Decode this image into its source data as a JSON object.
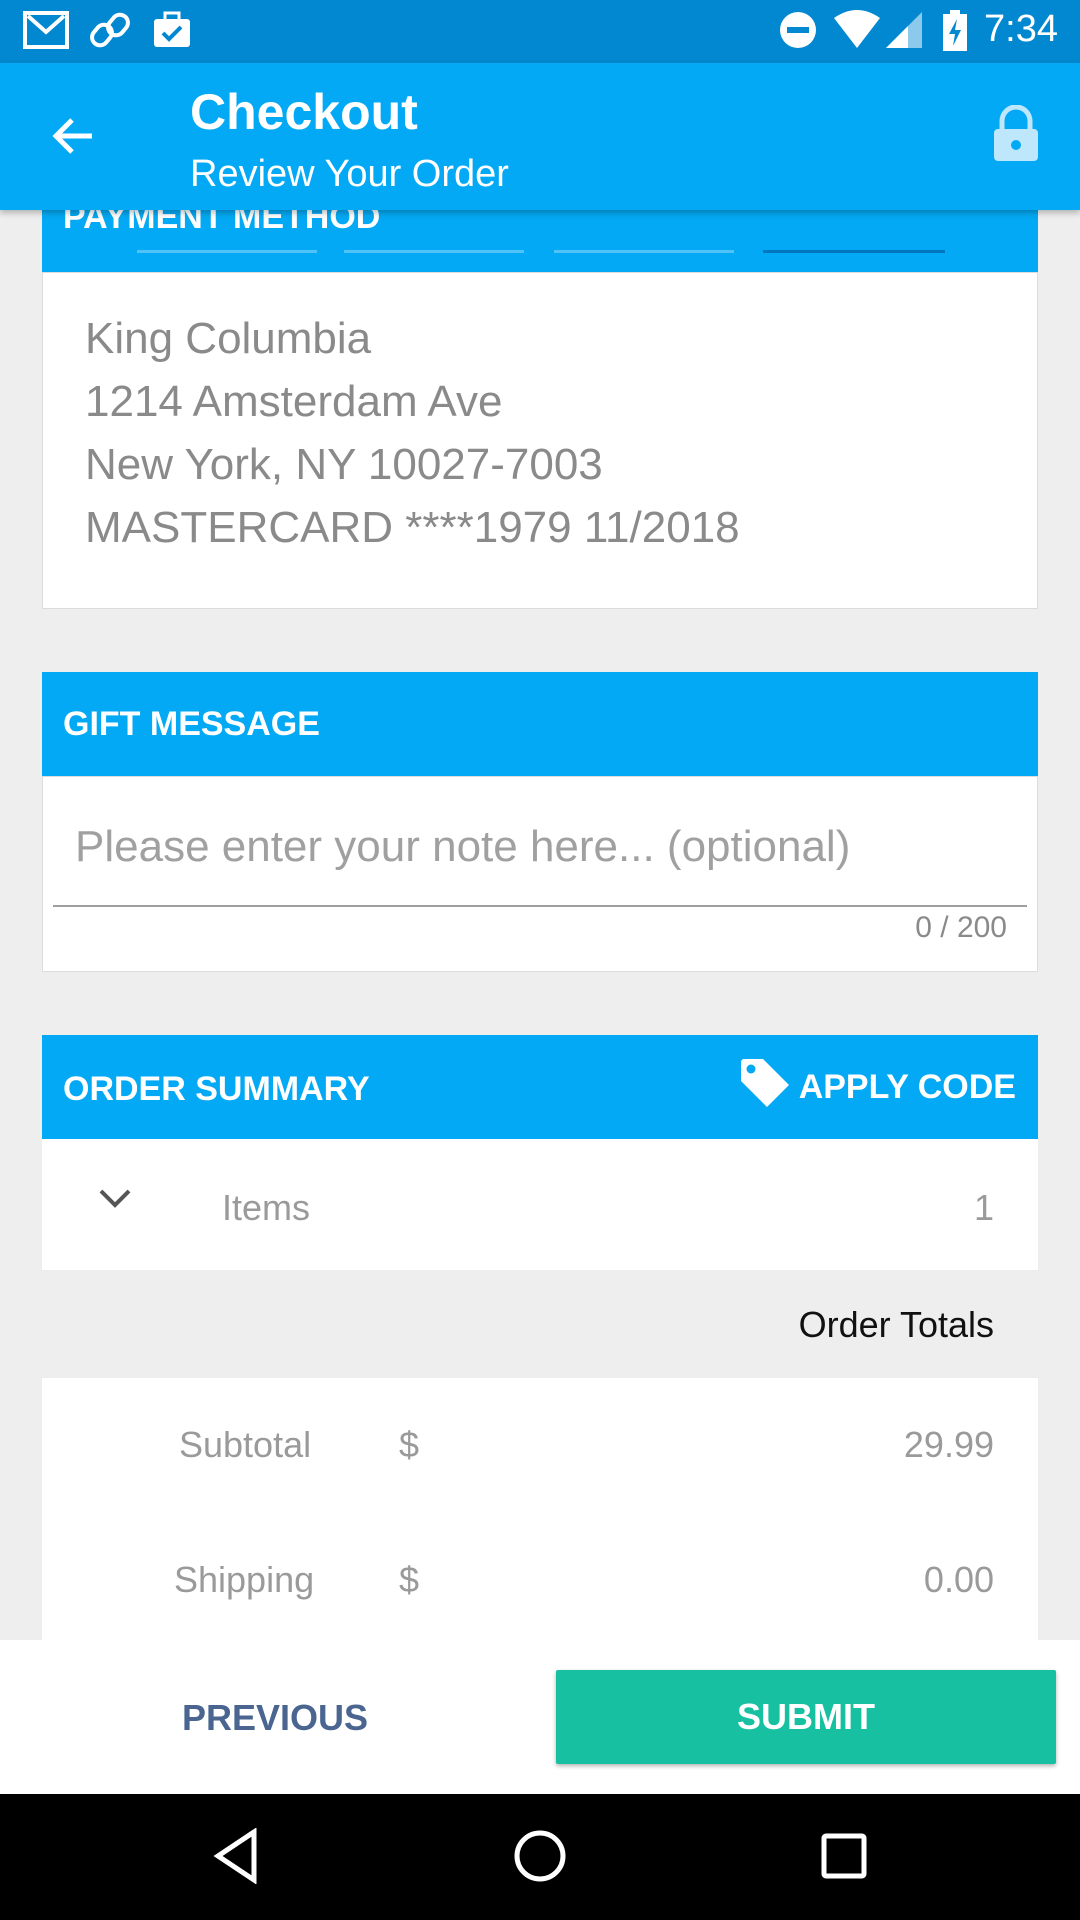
{
  "status_bar": {
    "time": "7:34",
    "left_icons": [
      "gmail-icon",
      "link-icon",
      "briefcase-check-icon"
    ],
    "right_icons": [
      "do-not-disturb-icon",
      "wifi-icon",
      "signal-icon",
      "battery-charging-icon"
    ]
  },
  "app_bar": {
    "title": "Checkout",
    "subtitle": "Review Your Order",
    "back_icon": "arrow-left-icon",
    "lock_icon": "lock-icon"
  },
  "payment_method": {
    "header": "PAYMENT METHOD",
    "lines": [
      "King Columbia",
      "1214 Amsterdam Ave",
      "New York, NY 10027-7003",
      "MASTERCARD ****1979 11/2018"
    ]
  },
  "gift_message": {
    "header": "GIFT MESSAGE",
    "placeholder": "Please enter your note here... (optional)",
    "value": "",
    "counter": "0 / 200"
  },
  "order_summary": {
    "header": "ORDER SUMMARY",
    "apply_code_label": "APPLY CODE",
    "items_label": "Items",
    "items_count": "1",
    "totals_header": "Order Totals",
    "rows": [
      {
        "label": "Subtotal",
        "currency": "$",
        "amount": "29.99"
      },
      {
        "label": "Shipping",
        "currency": "$",
        "amount": "0.00"
      }
    ]
  },
  "footer": {
    "previous_label": "PREVIOUS",
    "submit_label": "SUBMIT"
  },
  "colors": {
    "status_bar": "#0288d1",
    "primary": "#03a9f4",
    "submit": "#16c0a1",
    "previous_text": "#4a6690"
  }
}
